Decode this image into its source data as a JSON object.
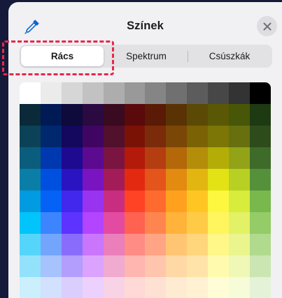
{
  "header": {
    "title": "Színek",
    "eyedropper_icon": "eyedropper-icon",
    "close_icon": "close-icon"
  },
  "segments": [
    {
      "label": "Rács",
      "selected": true
    },
    {
      "label": "Spektrum",
      "selected": false
    },
    {
      "label": "Csúszkák",
      "selected": false
    }
  ],
  "palette": {
    "rows": [
      [
        "#ffffff",
        "#ebebeb",
        "#d6d6d6",
        "#c2c2c2",
        "#adadad",
        "#999999",
        "#858585",
        "#707070",
        "#5c5c5c",
        "#474747",
        "#333333",
        "#000000"
      ],
      [
        "#0a2a3a",
        "#001a55",
        "#0e0a3c",
        "#2a0a40",
        "#3a0a20",
        "#5a0a0a",
        "#5a1a05",
        "#5a3305",
        "#5a4a05",
        "#5a5805",
        "#485608",
        "#1e3a12"
      ],
      [
        "#0c4257",
        "#00286e",
        "#14075e",
        "#400563",
        "#51102c",
        "#7a1305",
        "#7b2b0a",
        "#7b4706",
        "#7b6205",
        "#7b7605",
        "#676f0f",
        "#2e4b1c"
      ],
      [
        "#0a5d7c",
        "#0038b0",
        "#1e0a90",
        "#5c0a90",
        "#7a1441",
        "#b41a0a",
        "#b43e10",
        "#b46809",
        "#b48e0a",
        "#b4ad08",
        "#93a318",
        "#3f6b2a"
      ],
      [
        "#0b7ea8",
        "#0050e0",
        "#2a13c0",
        "#7a14c0",
        "#a31c5a",
        "#e32910",
        "#e3551a",
        "#e38a10",
        "#e3b510",
        "#e3e214",
        "#b8d024",
        "#55913a"
      ],
      [
        "#009be0",
        "#0462f6",
        "#4227ed",
        "#9933f0",
        "#c82d82",
        "#ff4324",
        "#ff6a2f",
        "#ffa11e",
        "#ffc623",
        "#fef740",
        "#d8ec3c",
        "#78b84d"
      ],
      [
        "#00c4fa",
        "#3d85ff",
        "#5c33ff",
        "#b344ff",
        "#e34aa2",
        "#ff6251",
        "#ff8550",
        "#ffb33b",
        "#ffcb47",
        "#fff55d",
        "#e3f166",
        "#94cc68"
      ],
      [
        "#56d5fb",
        "#74a5fc",
        "#8a6cfc",
        "#c976fd",
        "#ea7fbb",
        "#ff8c85",
        "#ffa585",
        "#ffc573",
        "#ffd67b",
        "#fff787",
        "#eaf58e",
        "#b0da8d"
      ],
      [
        "#93e2fc",
        "#a6c3fd",
        "#b39dfd",
        "#dba3fe",
        "#f1aad0",
        "#ffb5b0",
        "#ffc5ad",
        "#ffd8a5",
        "#ffe3a8",
        "#fffaae",
        "#f0f8b5",
        "#cbe6b3"
      ],
      [
        "#cbeffd",
        "#d2e1fe",
        "#d9cefe",
        "#ecd0fe",
        "#f8d3e6",
        "#ffd9d5",
        "#ffe1d4",
        "#ffebd2",
        "#fff1d2",
        "#fffdd5",
        "#f6fbd8",
        "#e4f2d8"
      ]
    ]
  }
}
